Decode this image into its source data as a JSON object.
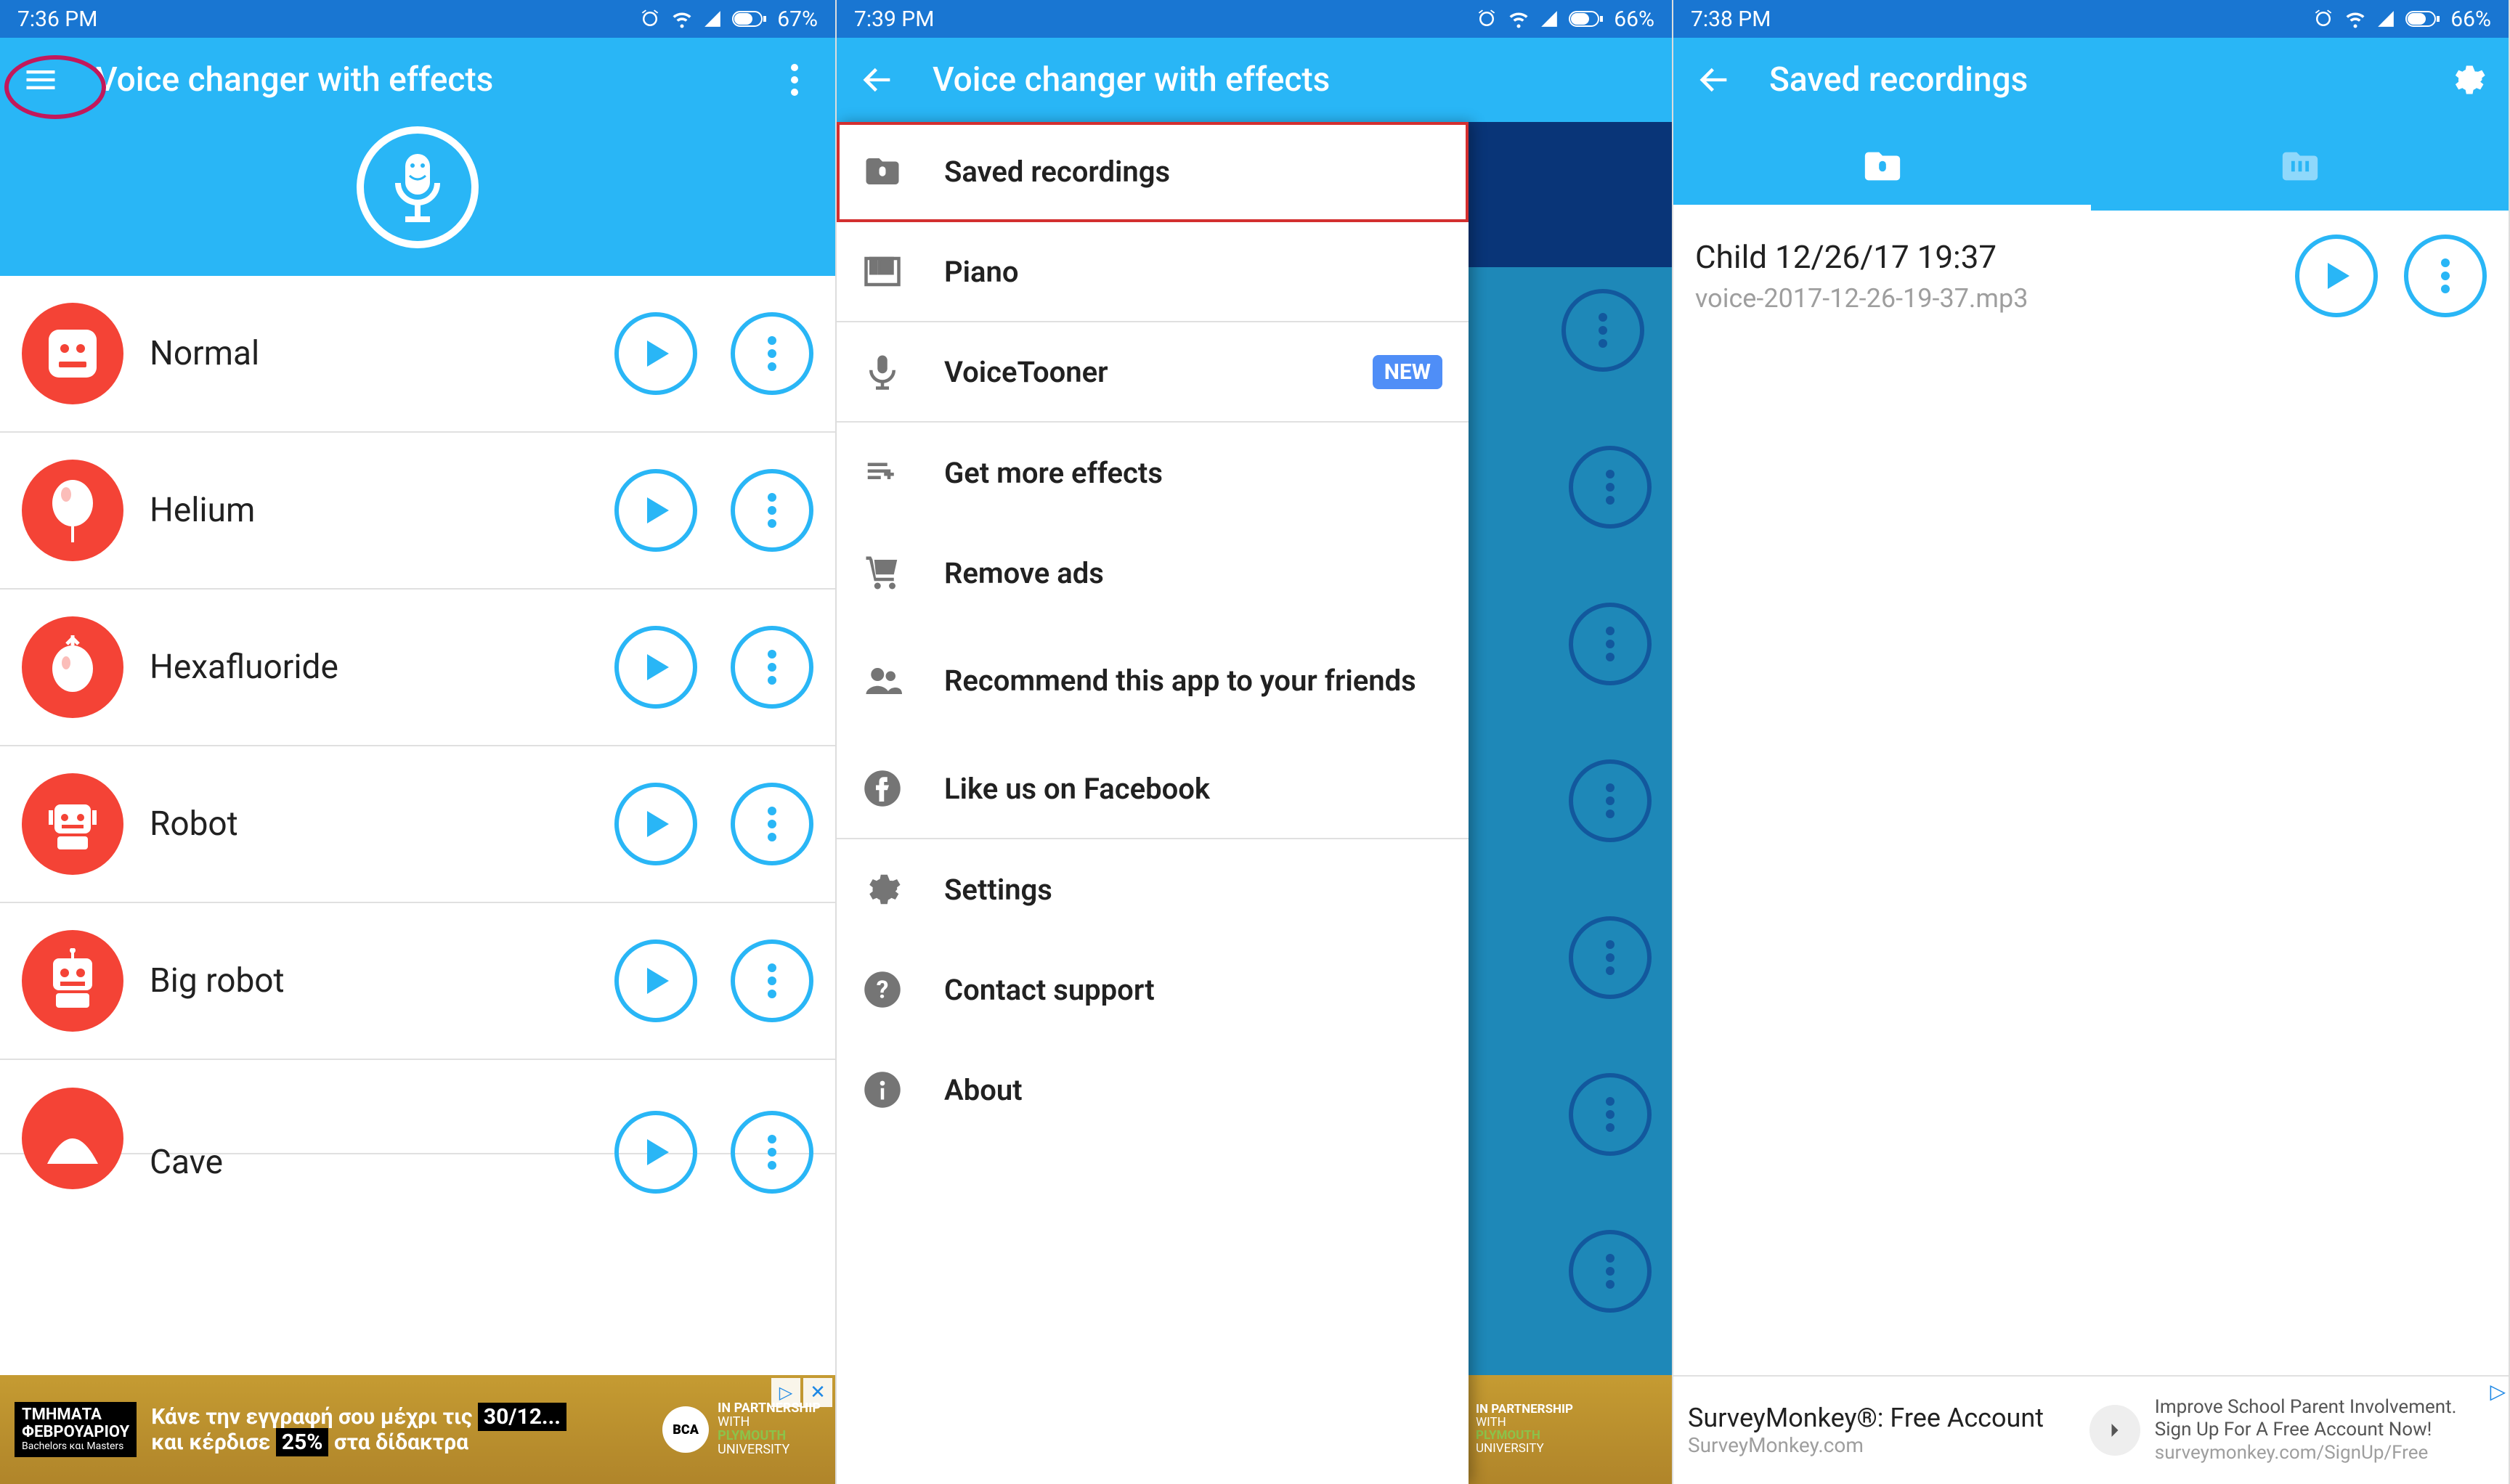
{
  "screen1": {
    "status": {
      "time": "7:36 PM",
      "battery": "67%"
    },
    "title": "Voice changer with effects",
    "effects": [
      {
        "label": "Normal"
      },
      {
        "label": "Helium"
      },
      {
        "label": "Hexafluoride"
      },
      {
        "label": "Robot"
      },
      {
        "label": "Big robot"
      },
      {
        "label": "Cave"
      }
    ],
    "ad": {
      "left_top": "ΤΜΗΜΑΤΑ",
      "left_bottom": "ΦΕΒΡΟΥΑΡΙΟΥ",
      "line1_a": "Κάνε την εγγραφή σου μέχρι τις",
      "line1_b": "30/12...",
      "line2_a": "και κέρδισε",
      "line2_b": "25%",
      "line2_c": "στα δίδακτρα",
      "partner1": "BCA COLLEGE",
      "partner2": "IN PARTNERSHIP WITH PLYMOUTH UNIVERSITY"
    }
  },
  "screen2": {
    "status": {
      "time": "7:39 PM",
      "battery": "66%"
    },
    "title": "Voice changer with effects",
    "drawer": [
      {
        "label": "Saved recordings"
      },
      {
        "label": "Piano"
      },
      {
        "label": "VoiceTooner",
        "badge": "NEW"
      },
      {
        "label": "Get more effects"
      },
      {
        "label": "Remove ads"
      },
      {
        "label": "Recommend this app to your friends"
      },
      {
        "label": "Like us on Facebook"
      },
      {
        "label": "Settings"
      },
      {
        "label": "Contact support"
      },
      {
        "label": "About"
      }
    ],
    "ad_partner": "PARTNERSHIP WITH PLYMOUTH UNIVERSITY"
  },
  "screen3": {
    "status": {
      "time": "7:38 PM",
      "battery": "66%"
    },
    "title": "Saved recordings",
    "recording": {
      "title": "Child 12/26/17 19:37",
      "file": "voice-2017-12-26-19-37.mp3"
    },
    "ad": {
      "headline": "SurveyMonkey®: Free Account",
      "sub": "SurveyMonkey.com",
      "body": "Improve School Parent Involvement. Sign Up For A Free Account Now!",
      "link": "surveymonkey.com/SignUp/Free"
    }
  }
}
